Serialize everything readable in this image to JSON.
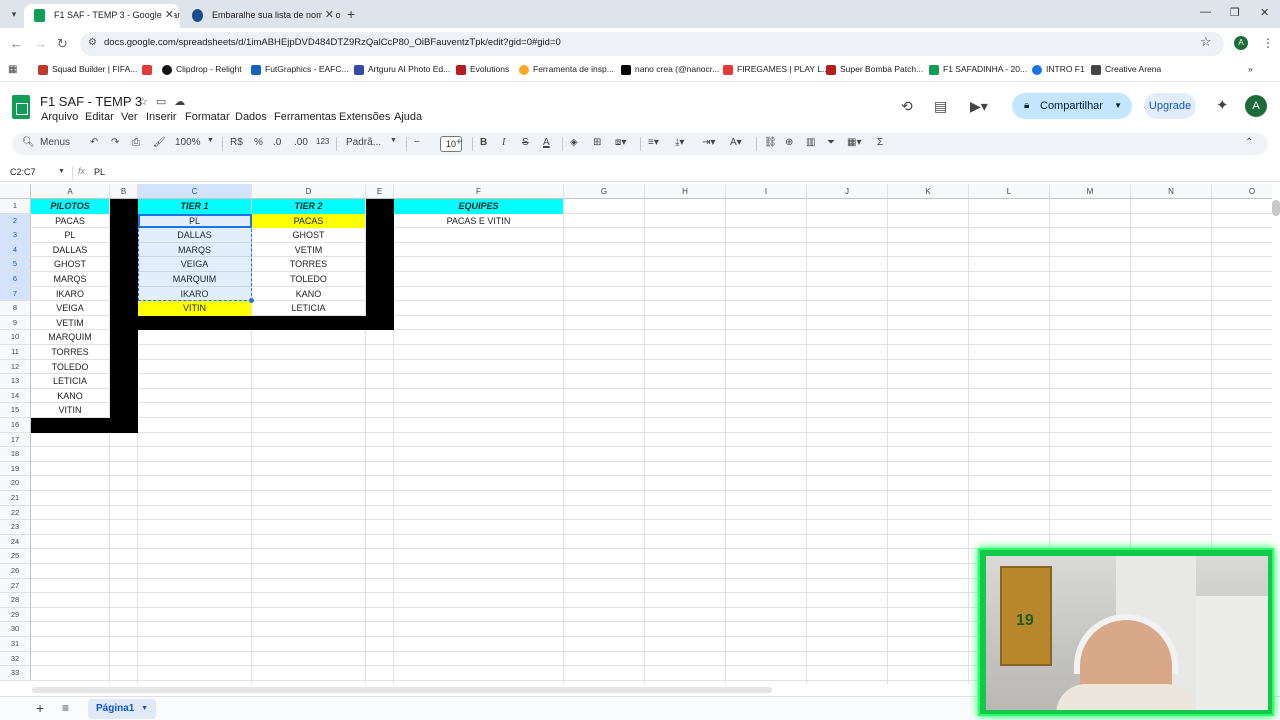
{
  "browser": {
    "tabs": [
      {
        "title": "F1 SAF - TEMP 3 - Google Planilhas",
        "active": true,
        "icon_color": "#0f9d58"
      },
      {
        "title": "Embaralhe sua lista de nomes o",
        "active": false,
        "icon_color": "#1a4d8f"
      }
    ],
    "url": "docs.google.com/spreadsheets/d/1imABHEjpDVD484DTZ9RzQalCcP80_OiBFauventzTpk/edit?gid=0#gid=0",
    "profile_letter": "A",
    "bookmarks": [
      {
        "label": "Squad Builder | FIFA...",
        "color": "#c0392b"
      },
      {
        "label": "Clipdrop - Relight",
        "color": "#111111"
      },
      {
        "label": "FutGraphics - EAFC...",
        "color": "#1565c0"
      },
      {
        "label": "Artguru AI Photo Ed...",
        "color": "#3949ab"
      },
      {
        "label": "Evolutions",
        "color": "#b71c1c"
      },
      {
        "label": "Ferramenta de insp...",
        "color": "#f9a825"
      },
      {
        "label": "nano crea (@nanocr...",
        "color": "#000000"
      },
      {
        "label": "FIREGAMES | PLAY L...",
        "color": "#e53935"
      },
      {
        "label": "Super Bomba Patch...",
        "color": "#b71c1c"
      },
      {
        "label": "F1 SAFADINHA - 20...",
        "color": "#0f9d58"
      },
      {
        "label": "INTRO F1",
        "color": "#1a73e8"
      },
      {
        "label": "Creative Arena",
        "color": "#444444"
      }
    ]
  },
  "doc": {
    "title": "F1 SAF - TEMP 3",
    "menus": [
      "Arquivo",
      "Editar",
      "Ver",
      "Inserir",
      "Formatar",
      "Dados",
      "Ferramentas",
      "Extensões",
      "Ajuda"
    ],
    "share_label": "Compartilhar",
    "upgrade_label": "Upgrade",
    "avatar_letter": "A"
  },
  "toolbar": {
    "menus_label": "Menus",
    "zoom": "100%",
    "currency": "R$",
    "percent": "%",
    "dec_less": ".0",
    "dec_more": ".00",
    "number_format": "123",
    "font": "Padrã...",
    "font_size": "10"
  },
  "formula": {
    "name_box": "C2:C7",
    "value": "PL"
  },
  "grid": {
    "columns": [
      "A",
      "B",
      "C",
      "D",
      "E",
      "F",
      "G",
      "H",
      "I",
      "J",
      "K",
      "L",
      "M",
      "N",
      "O"
    ],
    "selected_columns": [
      "C"
    ],
    "rows": [
      "1",
      "2",
      "3",
      "4",
      "5",
      "6",
      "7",
      "8",
      "9",
      "10",
      "11",
      "12",
      "13",
      "14",
      "15",
      "16",
      "17",
      "18",
      "19",
      "20",
      "21",
      "22",
      "23",
      "24",
      "25",
      "26",
      "27",
      "28",
      "29",
      "30",
      "31",
      "32",
      "33"
    ],
    "selected_rows": [
      "2",
      "3",
      "4",
      "5",
      "6",
      "7"
    ],
    "pilotos": {
      "header": "PILOTOS",
      "values": [
        "PACAS",
        "PL",
        "DALLAS",
        "GHOST",
        "MARQS",
        "IKARO",
        "VEIGA",
        "VETIM",
        "MARQUIM",
        "TORRES",
        "TOLEDO",
        "LETICIA",
        "KANO",
        "VITIN"
      ]
    },
    "tier1": {
      "header": "TIER 1",
      "values": [
        "PL",
        "DALLAS",
        "MARQS",
        "VEIGA",
        "MARQUIM",
        "IKARO",
        "VITIN"
      ],
      "highlighted": [
        6
      ]
    },
    "tier2": {
      "header": "TIER 2",
      "values": [
        "PACAS",
        "GHOST",
        "VETIM",
        "TORRES",
        "TOLEDO",
        "KANO",
        "LETICIA"
      ],
      "highlighted": [
        0
      ]
    },
    "equipes": {
      "header": "EQUIPES",
      "values": [
        "PACAS E VITIN"
      ]
    },
    "colors": {
      "header_fill": "#00ffff",
      "highlight_fill": "#ffff00",
      "border_fill": "#000000",
      "selection": "#1a73e8"
    }
  },
  "sheets": [
    {
      "name": "Página1",
      "active": true
    }
  ]
}
